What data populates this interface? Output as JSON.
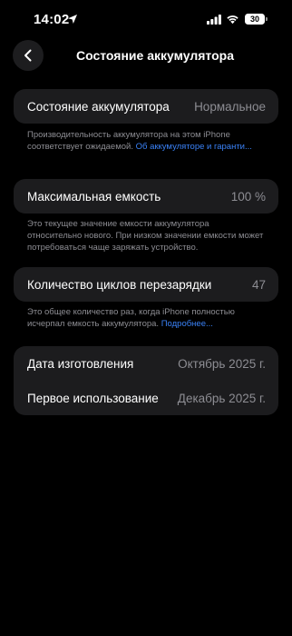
{
  "status_bar": {
    "time": "14:02",
    "battery_level": "30",
    "icons": [
      "location-arrow-icon",
      "signal-icon",
      "wifi-icon",
      "battery-icon"
    ]
  },
  "nav": {
    "back_icon": "chevron-left-icon",
    "title": "Состояние аккумулятора"
  },
  "health": {
    "label": "Состояние аккумулятора",
    "value": "Нормальное",
    "footnote_text": "Производительность аккумулятора на этом iPhone соответствует ожидаемой. ",
    "footnote_link": "Об аккумуляторе и гаранти..."
  },
  "capacity": {
    "label": "Максимальная емкость",
    "value": "100 %",
    "footnote_text": "Это текущее значение емкости аккумулятора относительно нового. При низком значении емкости может потребоваться чаще заряжать устройство."
  },
  "cycles": {
    "label": "Количество циклов перезарядки",
    "value": "47",
    "footnote_text": "Это общее количество раз, когда iPhone полностью исчерпал емкость аккумулятора. ",
    "footnote_link": "Подробнее..."
  },
  "dates": {
    "manufacture_label": "Дата изготовления",
    "manufacture_value": "Октябрь 2025 г.",
    "first_use_label": "Первое использование",
    "first_use_value": "Декабрь 2025 г."
  },
  "colors": {
    "background": "#000000",
    "card": "#1c1c1e",
    "secondary_text": "#8d8d93",
    "link": "#3a82f7"
  }
}
